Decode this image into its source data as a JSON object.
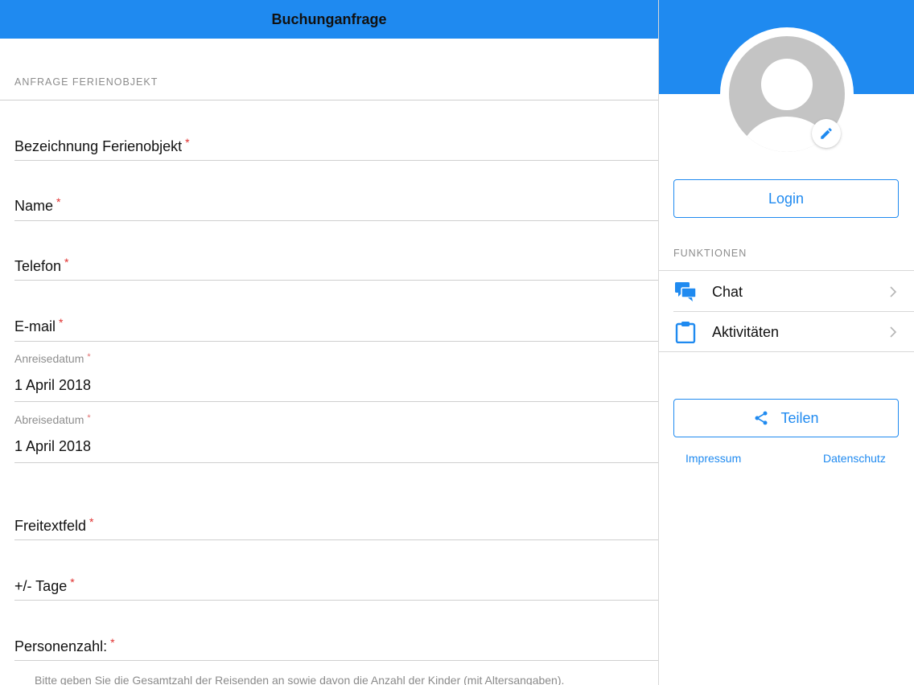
{
  "header": {
    "title": "Buchunganfrage"
  },
  "form": {
    "section_title": "ANFRAGE FERIENOBJEKT",
    "required_mark": "*",
    "fields": {
      "bezeichnung": "Bezeichnung Ferienobjekt",
      "name": "Name",
      "telefon": "Telefon",
      "email": "E-mail",
      "anreise_label": "Anreisedatum",
      "anreise_value": "1 April 2018",
      "abreise_label": "Abreisedatum",
      "abreise_value": "1 April 2018",
      "freitext": "Freitextfeld",
      "tage": "+/- Tage",
      "personen": "Personenzahl:"
    },
    "hint": "Bitte geben Sie die Gesamtzahl der Reisenden an sowie davon die Anzahl der Kinder (mit Altersangaben)."
  },
  "side": {
    "login_label": "Login",
    "section_title": "FUNKTIONEN",
    "menu": [
      {
        "label": "Chat",
        "icon": "chat-icon"
      },
      {
        "label": "Aktivitäten",
        "icon": "clipboard-icon"
      }
    ],
    "share_label": "Teilen",
    "impressum": "Impressum",
    "datenschutz": "Datenschutz"
  },
  "colors": {
    "accent": "#1f8af0",
    "required": "#e0302f",
    "muted": "#8c8c8c"
  }
}
